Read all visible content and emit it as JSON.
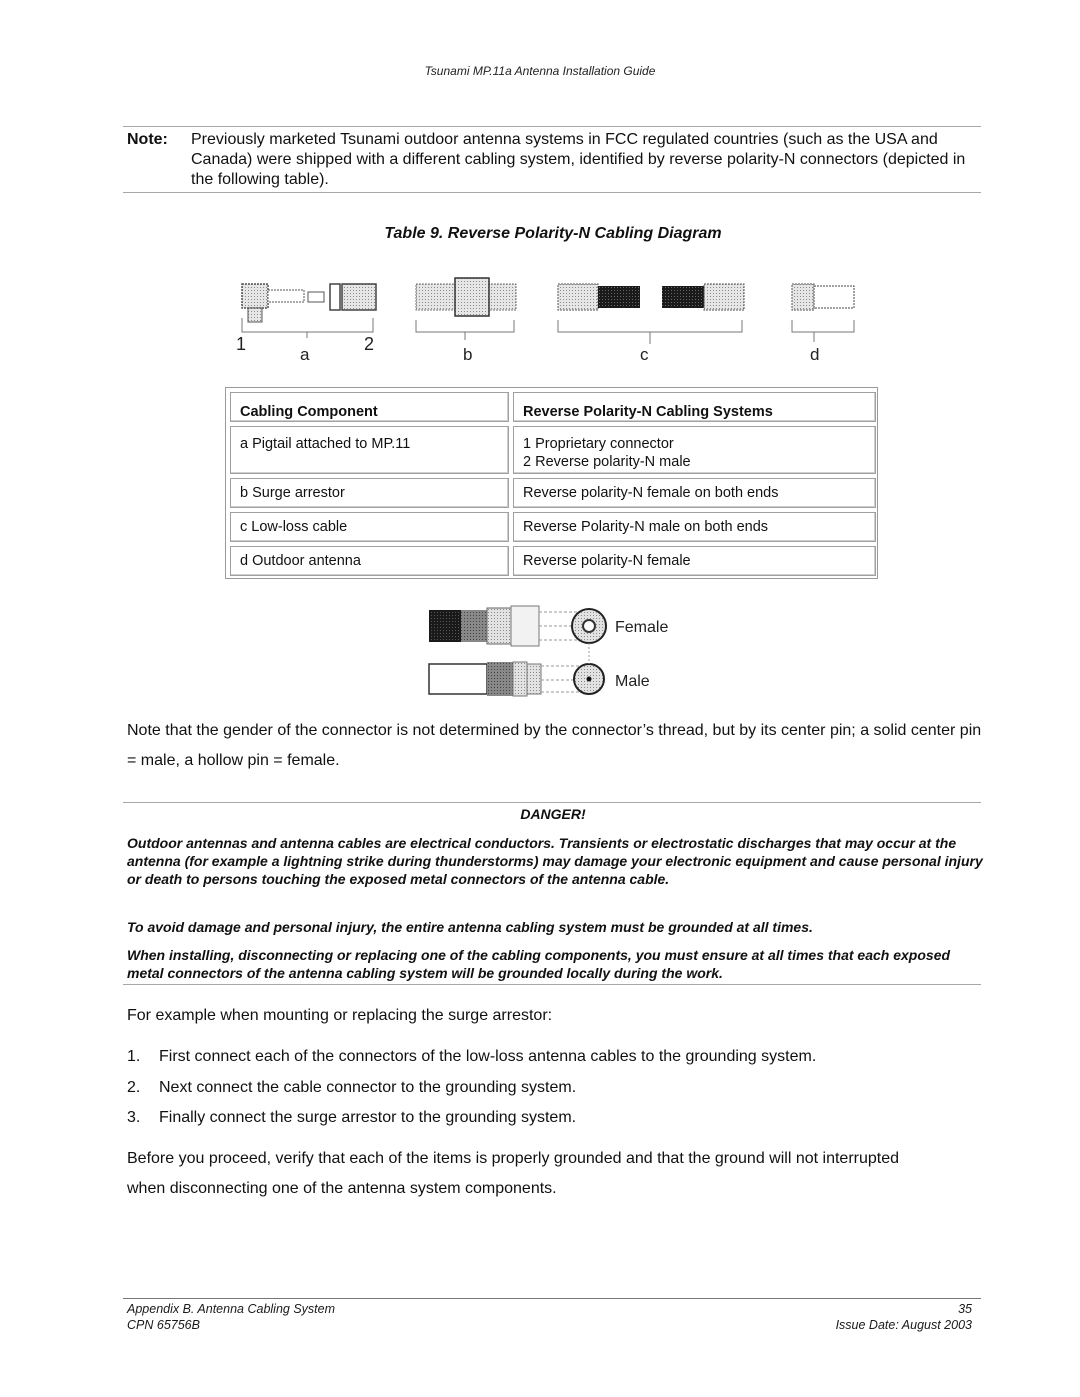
{
  "header": {
    "running_title": "Tsunami MP.11a Antenna Installation Guide"
  },
  "note": {
    "label": "Note:",
    "text": "Previously marketed Tsunami outdoor antenna systems in FCC regulated countries (such as the USA and Canada) were shipped with a different cabling system, identified by reverse polarity-N connectors (depicted in the following table)."
  },
  "table": {
    "title": "Table 9.  Reverse Polarity-N Cabling Diagram",
    "diagram_labels": {
      "a": "a",
      "b": "b",
      "c": "c",
      "d": "d",
      "one": "1",
      "two": "2"
    },
    "headers": [
      "Cabling Component",
      "Reverse Polarity-N Cabling Systems"
    ],
    "rows": [
      {
        "component": "a  Pigtail attached to MP.11",
        "system_line1": "1  Proprietary connector",
        "system_line2": "2  Reverse polarity-N male"
      },
      {
        "component": "b  Surge arrestor",
        "system_line1": "Reverse polarity-N female on both ends",
        "system_line2": ""
      },
      {
        "component": "c  Low-loss cable",
        "system_line1": "Reverse Polarity-N male on both ends",
        "system_line2": ""
      },
      {
        "component": "d  Outdoor antenna",
        "system_line1": "Reverse polarity-N female",
        "system_line2": ""
      }
    ]
  },
  "gender_figure": {
    "female_label": "Female",
    "male_label": "Male"
  },
  "gender_paragraph": "Note that the gender of the connector is not determined by the connector’s thread, but by its center pin; a solid center pin = male, a hollow pin = female.",
  "danger": {
    "title": "DANGER!",
    "paragraphs": [
      "Outdoor antennas and antenna cables are electrical conductors. Transients or electrostatic discharges that may occur at the antenna (for example a lightning strike during thunderstorms) may damage your electronic equipment and cause personal injury or death to persons touching the exposed metal connectors of the antenna cable.",
      "To avoid damage and personal injury, the entire antenna cabling system must be grounded at all times.",
      "When installing, disconnecting or replacing one of the cabling components, you must ensure at all times that each exposed metal connectors of the antenna cabling system will be grounded locally during the work."
    ]
  },
  "example_intro": "For example when mounting or replacing the surge arrestor:",
  "steps": [
    {
      "num": "1.",
      "text": "First connect each of the connectors of the low-loss antenna cables to the grounding system."
    },
    {
      "num": "2.",
      "text": "Next connect the cable connector to the grounding system."
    },
    {
      "num": "3.",
      "text": "Finally connect the surge arrestor to the grounding system."
    }
  ],
  "closing_paragraph": "Before you proceed, verify that each of the items is properly grounded and that the ground will not interrupted when disconnecting one of the antenna system components.",
  "footer": {
    "section": "Appendix B.  Antenna Cabling System",
    "cpn": "CPN 65756B",
    "page_number": "35",
    "issue_date": "Issue Date:  August 2003"
  }
}
